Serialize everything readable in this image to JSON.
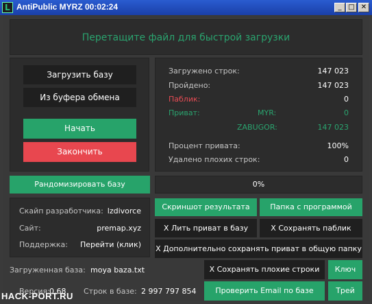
{
  "window": {
    "title": "AntiPublic MYRZ 00:02:24",
    "minimize_glyph": "_",
    "maximize_glyph": "□",
    "close_glyph": "✕",
    "icon_letter": "L"
  },
  "drop_zone": {
    "text": "Перетащите файл для быстрой загрузки"
  },
  "left_buttons": {
    "load_base": "Загрузить базу",
    "from_clipboard": "Из буфера обмена",
    "start": "Начать",
    "finish": "Закончить"
  },
  "stats": {
    "loaded_lines_label": "Загружено строк:",
    "loaded_lines_value": "147 023",
    "passed_label": "Пройдено:",
    "passed_value": "147 023",
    "public_label": "Паблик:",
    "public_value": "0",
    "private_label": "Приват:",
    "myr_label": "MYR:",
    "myr_value": "0",
    "zabugor_label": "ZABUGOR:",
    "zabugor_value": "147 023",
    "private_percent_label": "Процент привата:",
    "private_percent_value": "100%",
    "bad_lines_label": "Удалено плохих строк:",
    "bad_lines_value": "0"
  },
  "randomize_button": "Рандомизировать базу",
  "progress": {
    "text": "0%",
    "fraction": 0.0
  },
  "info": {
    "dev_skype_label": "Скайп разработчика:",
    "dev_skype_value": "lzdivorce",
    "site_label": "Сайт:",
    "site_value": "premap.xyz",
    "support_label": "Поддержка:",
    "support_value": "Перейти (клик)"
  },
  "action_buttons": {
    "screenshot": "Скриншот результата",
    "program_folder": "Папка с программой",
    "pour_private": "X Лить приват в базу",
    "save_public": "X Сохранять паблик",
    "save_private_common": "X Дополнительно сохранять приват в общую папку",
    "save_bad_lines": "X Сохранять плохие строки",
    "key": "Ключ",
    "check_email": "Проверить Email по базе",
    "trial": "Трей"
  },
  "bottom": {
    "loaded_base_label": "Загруженная база:",
    "loaded_base_value": "moya baza.txt",
    "version_label": "Версия:",
    "version_value": "0.68",
    "lines_in_base_label": "Строк в базе:",
    "lines_in_base_value": "2 997 797 854"
  },
  "watermark": "HACK-PORT.RU"
}
